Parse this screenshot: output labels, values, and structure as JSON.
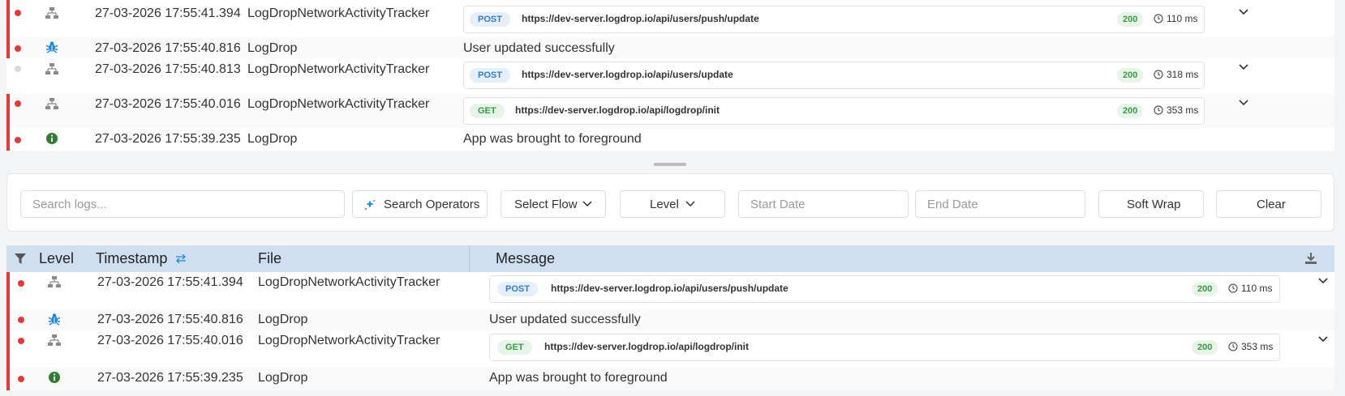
{
  "top_log": {
    "rows": [
      {
        "timestamp": "27-03-2026 17:55:41.394",
        "file": "LogDropNetworkActivityTracker",
        "method": "POST",
        "url": "https://dev-server.logdrop.io/api/users/push/update",
        "status": "200",
        "duration": "110 ms"
      },
      {
        "timestamp": "27-03-2026 17:55:40.816",
        "file": "LogDrop",
        "message": "User updated successfully"
      },
      {
        "timestamp": "27-03-2026 17:55:40.813",
        "file": "LogDropNetworkActivityTracker",
        "method": "POST",
        "url": "https://dev-server.logdrop.io/api/users/update",
        "status": "200",
        "duration": "318 ms"
      },
      {
        "timestamp": "27-03-2026 17:55:40.016",
        "file": "LogDropNetworkActivityTracker",
        "method": "GET",
        "url": "https://dev-server.logdrop.io/api/logdrop/init",
        "status": "200",
        "duration": "353 ms"
      },
      {
        "timestamp": "27-03-2026 17:55:39.235",
        "file": "LogDrop",
        "message": "App was brought to foreground"
      }
    ]
  },
  "toolbar": {
    "search_placeholder": "Search logs...",
    "search_operators": "Search Operators",
    "select_flow": "Select Flow",
    "level": "Level",
    "start_date_placeholder": "Start Date",
    "end_date_placeholder": "End Date",
    "soft_wrap": "Soft Wrap",
    "clear": "Clear"
  },
  "table": {
    "headers": {
      "level": "Level",
      "timestamp": "Timestamp",
      "file": "File",
      "message": "Message"
    },
    "rows": [
      {
        "timestamp": "27-03-2026 17:55:41.394",
        "file": "LogDropNetworkActivityTracker",
        "method": "POST",
        "url": "https://dev-server.logdrop.io/api/users/push/update",
        "status": "200",
        "duration": "110 ms"
      },
      {
        "timestamp": "27-03-2026 17:55:40.816",
        "file": "LogDrop",
        "message": "User updated successfully"
      },
      {
        "timestamp": "27-03-2026 17:55:40.016",
        "file": "LogDropNetworkActivityTracker",
        "method": "GET",
        "url": "https://dev-server.logdrop.io/api/logdrop/init",
        "status": "200",
        "duration": "353 ms"
      },
      {
        "timestamp": "27-03-2026 17:55:39.235",
        "file": "LogDrop",
        "message": "App was brought to foreground"
      }
    ]
  },
  "icons": {
    "network": "network-icon",
    "debug": "bug-icon",
    "info": "info-icon",
    "clock": "clock-icon",
    "chevron": "chevron-down-icon",
    "filter": "filter-icon",
    "sort": "sort-icon",
    "download": "download-icon",
    "sparkle": "sparkle-icon"
  },
  "colors": {
    "error": "#e53935",
    "neutral": "#d9d9d9",
    "debug": "#1e88e5",
    "info": "#2e7d32",
    "header_bg": "#cfdff0"
  }
}
